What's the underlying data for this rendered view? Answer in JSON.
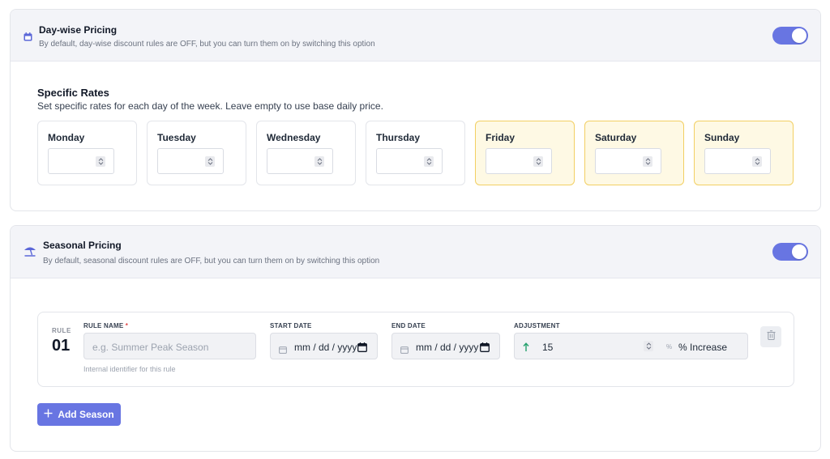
{
  "daywise": {
    "title": "Day-wise Pricing",
    "description": "By default, day-wise discount rules are OFF, but you can turn them on by switching this option",
    "icon": "calendar-icon",
    "toggle_on": true,
    "specific_rates": {
      "title": "Specific Rates",
      "subtitle": "Set specific rates for each day of the week. Leave empty to use base daily price."
    },
    "days": [
      {
        "label": "Monday",
        "value": "",
        "weekend": false
      },
      {
        "label": "Tuesday",
        "value": "",
        "weekend": false
      },
      {
        "label": "Wednesday",
        "value": "",
        "weekend": false
      },
      {
        "label": "Thursday",
        "value": "",
        "weekend": false
      },
      {
        "label": "Friday",
        "value": "",
        "weekend": true
      },
      {
        "label": "Saturday",
        "value": "",
        "weekend": true
      },
      {
        "label": "Sunday",
        "value": "",
        "weekend": true
      }
    ]
  },
  "seasonal": {
    "title": "Seasonal Pricing",
    "description": "By default, seasonal discount rules are OFF, but you can turn them on by switching this option",
    "icon": "beach-umbrella-icon",
    "toggle_on": true,
    "rule": {
      "tag": "RULE",
      "number": "01",
      "name_label": "RULE NAME",
      "required_mark": "*",
      "name_placeholder": "e.g. Summer Peak Season",
      "name_hint": "Internal identifier for this rule",
      "start_label": "START DATE",
      "start_value": "mm / dd / yyyy",
      "end_label": "END DATE",
      "end_value": "mm / dd / yyyy",
      "adjustment_label": "ADJUSTMENT",
      "adjustment_value": "15",
      "adjustment_type": "% Increase"
    },
    "add_button": "Add Season"
  },
  "colors": {
    "accent": "#6875e2",
    "weekend_bg": "#fef9e4",
    "weekend_border": "#f2cf63",
    "increase_arrow": "#22a06b"
  }
}
